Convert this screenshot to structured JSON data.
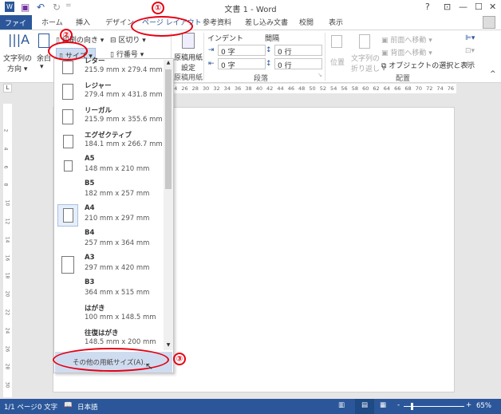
{
  "window": {
    "title": "文書 1 - Word",
    "help": "?",
    "restore_ribbon": "⊡",
    "minimize": "—",
    "maximize": "☐",
    "close": "✕"
  },
  "qat": {
    "save": "💾",
    "undo": "↶",
    "redo": "↻",
    "customize": "="
  },
  "tabs": [
    "ファイル",
    "ホーム",
    "挿入",
    "デザイン",
    "ページ レイアウト",
    "参考資料",
    "差し込み文書",
    "校閲",
    "表示"
  ],
  "ribbon": {
    "text_direction": [
      "文字列の",
      "方向 ▾"
    ],
    "margins": [
      "余白",
      "▾"
    ],
    "orientation": "印刷の向き ▾",
    "size": "サイズ ▾",
    "breaks": "区切り ▾",
    "line_numbers": "行番号 ▾",
    "genko": [
      "原稿用紙",
      "設定"
    ],
    "genko_group": "原稿用紙",
    "indent_label": "インデント",
    "spacing_label": "間隔",
    "indent_left": "0 字",
    "indent_right": "0 字",
    "space_before": "0 行",
    "space_after": "0 行",
    "paragraph_group": "段落",
    "position": "位置",
    "wrap": [
      "文字列の",
      "折り返し ▾"
    ],
    "bring_forward": "前面へ移動 ▾",
    "send_backward": "背面へ移動 ▾",
    "selection_pane": "オブジェクトの選択と表示",
    "arrange_group": "配置",
    "collapse": "^"
  },
  "ruler": {
    "h_marks": "24 26 28 30 32 34 36 38 40 42 44 46 48 50 52 54 56 58 60 62 64 66 68 70 72 74 76 78",
    "v_marks": [
      "2",
      "4",
      "6",
      "8",
      "10",
      "12",
      "14",
      "16",
      "18",
      "20",
      "22",
      "24",
      "26",
      "28",
      "30",
      "32"
    ]
  },
  "size_menu": {
    "items": [
      {
        "name": "レター",
        "dims": "215.9 mm x 279.4 mm"
      },
      {
        "name": "レジャー",
        "dims": "279.4 mm x 431.8 mm"
      },
      {
        "name": "リーガル",
        "dims": "215.9 mm x 355.6 mm"
      },
      {
        "name": "エグゼクティブ",
        "dims": "184.1 mm x 266.7 mm"
      },
      {
        "name": "A5",
        "dims": "148 mm x 210 mm"
      },
      {
        "name": "B5",
        "dims": "182 mm x 257 mm"
      },
      {
        "name": "A4",
        "dims": "210 mm x 297 mm"
      },
      {
        "name": "B4",
        "dims": "257 mm x 364 mm"
      },
      {
        "name": "A3",
        "dims": "297 mm x 420 mm"
      },
      {
        "name": "B3",
        "dims": "364 mm x 515 mm"
      },
      {
        "name": "はがき",
        "dims": "100 mm x 148.5 mm"
      },
      {
        "name": "往復はがき",
        "dims": "148.5 mm x 200 mm"
      }
    ],
    "selected": "A4",
    "more": "その他の用紙サイズ(A)..."
  },
  "annotations": [
    "①",
    "②",
    "③"
  ],
  "status": {
    "page": "1/1 ページ",
    "words": "0 文字",
    "language": "日本語",
    "zoom": "65%",
    "zoom_percent": 65
  },
  "colors": {
    "accent": "#2b579a",
    "annotation": "#e60012",
    "highlight": "#cfdcf0"
  }
}
